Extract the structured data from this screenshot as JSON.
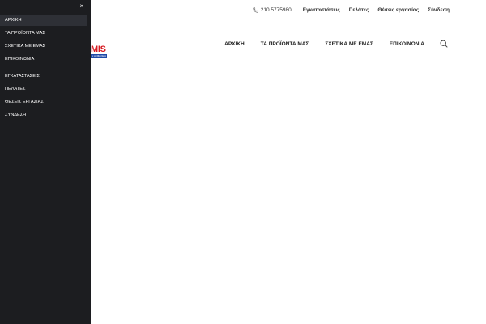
{
  "topbar": {
    "phone_icon": "phone-icon",
    "phone": "210 5775980",
    "links": [
      "Εγκαταστάσεις",
      "Πελάτες",
      "Θέσεις εργασίας",
      "Σύνδεση"
    ]
  },
  "logo": {
    "text": "MIS",
    "tagline": "Η ΑΣΦΑΛΕΙΑ"
  },
  "nav": {
    "items": [
      "ΑΡΧΙΚΗ",
      "ΤΑ ΠΡΟΪΟΝΤΑ ΜΑΣ",
      "ΣΧΕΤΙΚΑ ΜΕ ΕΜΑΣ",
      "ΕΠΙΚΟΙΝΩΝΙΑ"
    ],
    "search_icon": "search-icon"
  },
  "drawer": {
    "close_label": "×",
    "primary": [
      "ΑΡΧΙΚΗ",
      "ΤΑ ΠΡΟΪΟΝΤΑ ΜΑΣ",
      "ΣΧΕΤΙΚΑ ΜΕ ΕΜΑΣ",
      "ΕΠΙΚΟΙΝΩΝΙΑ"
    ],
    "secondary": [
      "ΕΓΚΑΤΑΣΤΑΣΕΙΣ",
      "ΠΕΛΑΤΕΣ",
      "ΘΕΣΕΙΣ ΕΡΓΑΣΙΑΣ",
      "ΣΥΝΔΕΣΗ"
    ],
    "active_index": 0
  },
  "colors": {
    "drawer_bg": "#1c1d20",
    "drawer_active": "#2e3036",
    "brand_red": "#d71920",
    "brand_blue": "#1f4aa8"
  }
}
